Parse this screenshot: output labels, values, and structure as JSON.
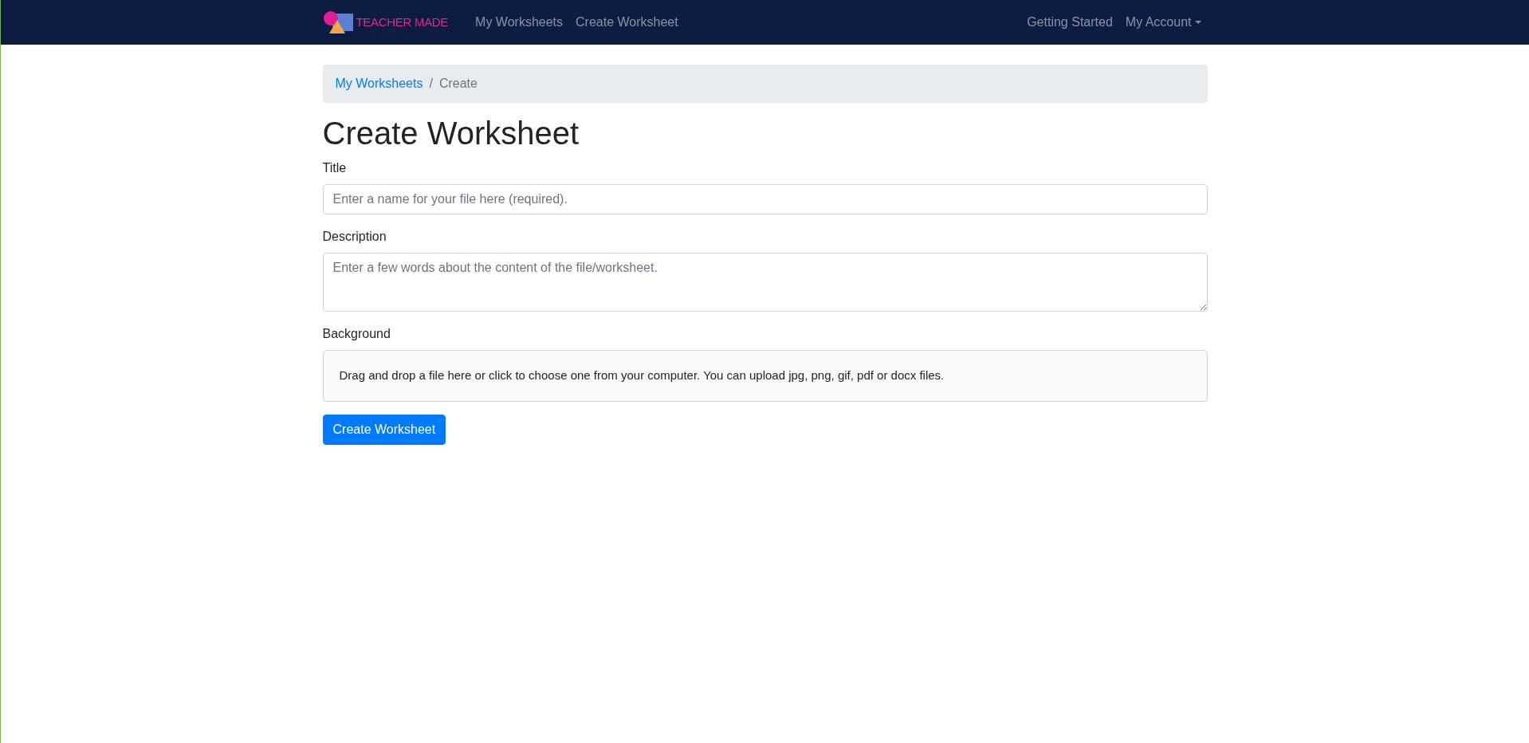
{
  "navbar": {
    "brand": "TEACHER MADE",
    "links": [
      {
        "label": "My Worksheets"
      },
      {
        "label": "Create Worksheet"
      }
    ],
    "right_links": [
      {
        "label": "Getting Started",
        "kind": "link"
      },
      {
        "label": "My Account",
        "kind": "dropdown"
      }
    ]
  },
  "breadcrumb": {
    "items": [
      {
        "label": "My Worksheets",
        "kind": "link"
      },
      {
        "label": "Create",
        "kind": "current"
      }
    ],
    "separator": "/"
  },
  "heading": "Create Worksheet",
  "form": {
    "fields": [
      {
        "label": "Title",
        "kind": "input",
        "placeholder": "Enter a name for your file here (required)."
      },
      {
        "label": "Description",
        "kind": "textarea",
        "placeholder": "Enter a few words about the content of the file/worksheet."
      },
      {
        "label": "Background",
        "kind": "dropzone",
        "text": "Drag and drop a file here or click to choose one from your computer. You can upload jpg, png, gif, pdf or docx files."
      }
    ],
    "submit": "Create Worksheet"
  }
}
